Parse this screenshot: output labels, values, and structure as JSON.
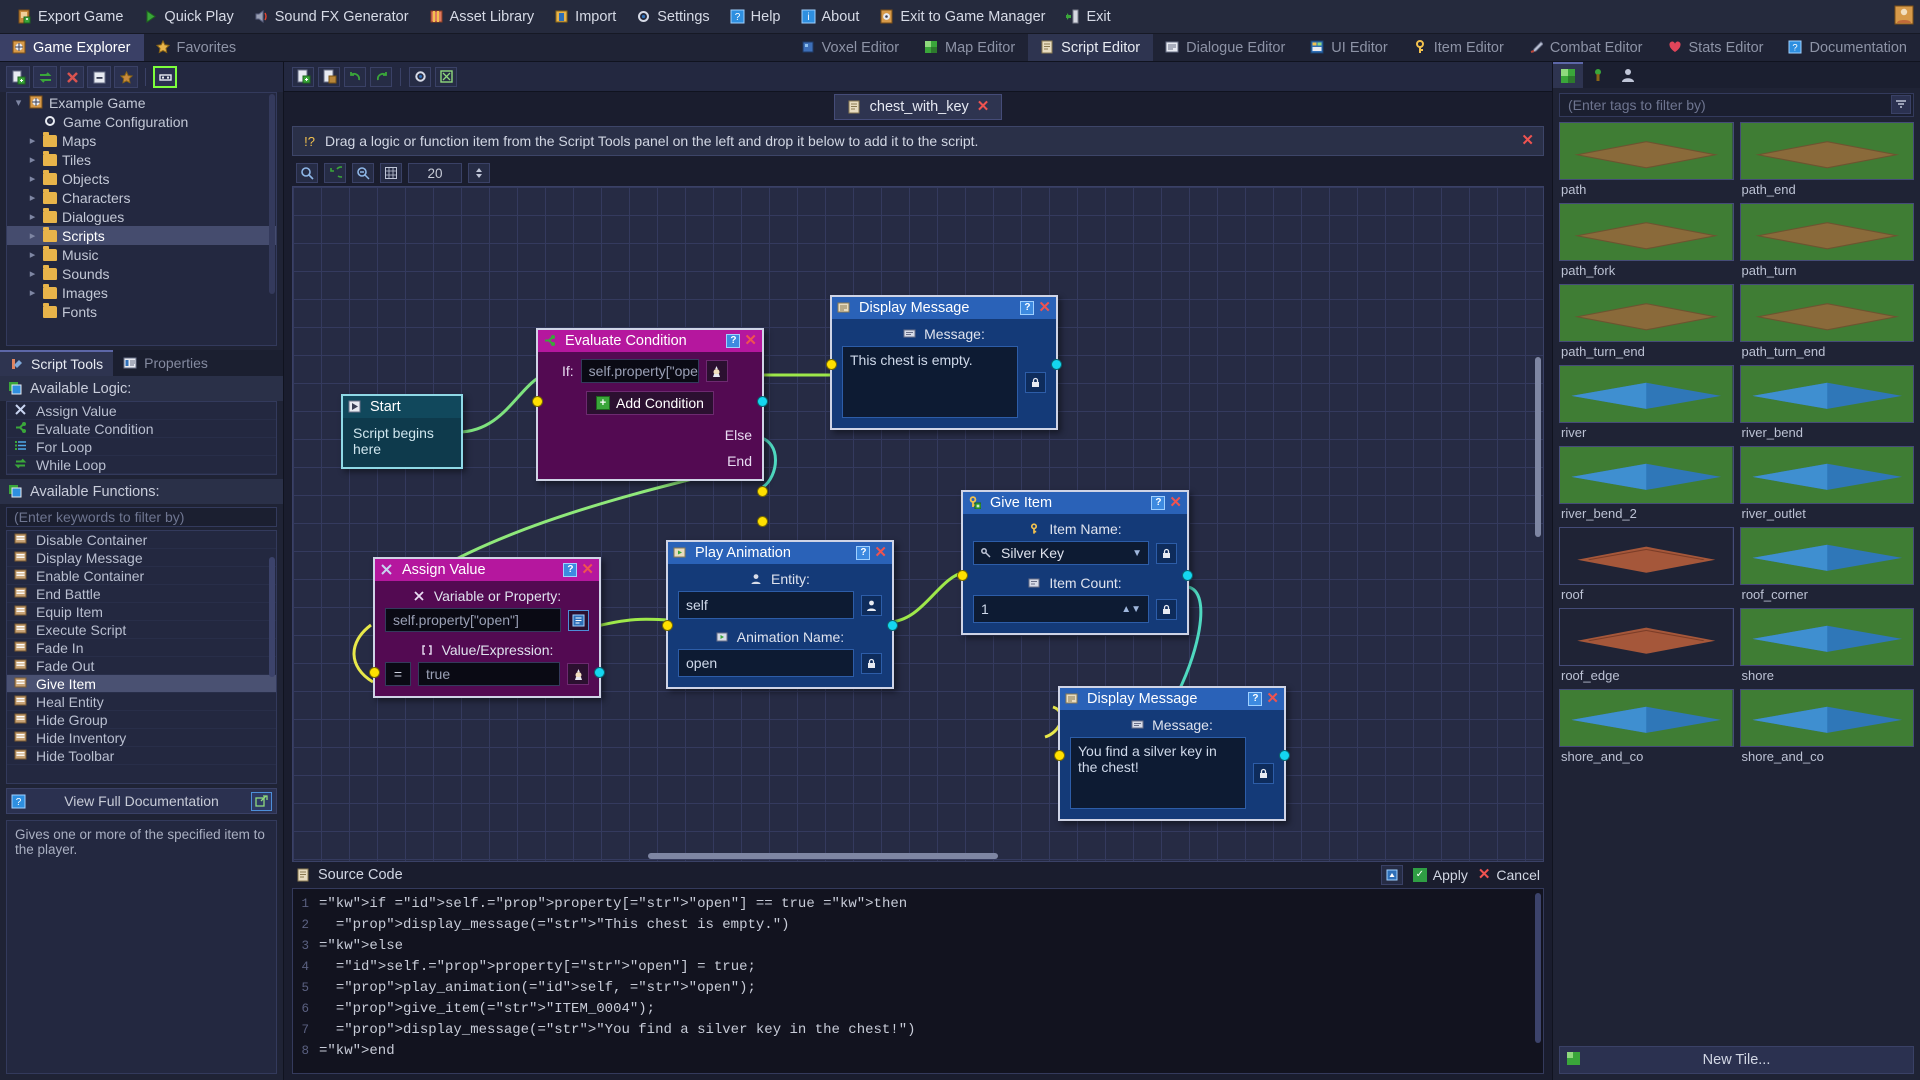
{
  "menubar": {
    "items": [
      {
        "label": "Export Game",
        "icon": "export-icon"
      },
      {
        "label": "Quick Play",
        "icon": "play-icon"
      },
      {
        "label": "Sound FX Generator",
        "icon": "speaker-icon"
      },
      {
        "label": "Asset Library",
        "icon": "library-icon"
      },
      {
        "label": "Import",
        "icon": "import-icon"
      },
      {
        "label": "Settings",
        "icon": "gear-icon"
      },
      {
        "label": "Help",
        "icon": "question-icon"
      },
      {
        "label": "About",
        "icon": "info-icon"
      },
      {
        "label": "Exit to Game Manager",
        "icon": "door-icon"
      },
      {
        "label": "Exit",
        "icon": "exit-icon"
      }
    ]
  },
  "tabbar": {
    "left": [
      {
        "label": "Game Explorer",
        "active": true
      },
      {
        "label": "Favorites",
        "active": false
      }
    ],
    "right": [
      {
        "label": "Voxel Editor",
        "active": false
      },
      {
        "label": "Map Editor",
        "active": false
      },
      {
        "label": "Script Editor",
        "active": true
      },
      {
        "label": "Dialogue Editor",
        "active": false
      },
      {
        "label": "UI Editor",
        "active": false
      },
      {
        "label": "Item Editor",
        "active": false
      },
      {
        "label": "Combat Editor",
        "active": false
      },
      {
        "label": "Stats Editor",
        "active": false
      },
      {
        "label": "Documentation",
        "active": false
      }
    ]
  },
  "explorer": {
    "toolbar": [
      "new-file-icon",
      "refresh-icon",
      "delete-icon",
      "collapse-icon",
      "favorite-icon",
      "rename-icon"
    ],
    "tree": [
      {
        "label": "Example Game",
        "depth": 0,
        "twisty": "v",
        "icon": "game-icon",
        "selected": false
      },
      {
        "label": "Game Configuration",
        "depth": 1,
        "twisty": "",
        "icon": "gear-icon",
        "selected": false
      },
      {
        "label": "Maps",
        "depth": 1,
        "twisty": ">",
        "icon": "folder",
        "selected": false
      },
      {
        "label": "Tiles",
        "depth": 1,
        "twisty": ">",
        "icon": "folder",
        "selected": false
      },
      {
        "label": "Objects",
        "depth": 1,
        "twisty": ">",
        "icon": "folder",
        "selected": false
      },
      {
        "label": "Characters",
        "depth": 1,
        "twisty": ">",
        "icon": "folder",
        "selected": false
      },
      {
        "label": "Dialogues",
        "depth": 1,
        "twisty": ">",
        "icon": "folder",
        "selected": false
      },
      {
        "label": "Scripts",
        "depth": 1,
        "twisty": ">",
        "icon": "folder",
        "selected": true
      },
      {
        "label": "Music",
        "depth": 1,
        "twisty": ">",
        "icon": "folder",
        "selected": false
      },
      {
        "label": "Sounds",
        "depth": 1,
        "twisty": ">",
        "icon": "folder",
        "selected": false
      },
      {
        "label": "Images",
        "depth": 1,
        "twisty": ">",
        "icon": "folder",
        "selected": false
      },
      {
        "label": "Fonts",
        "depth": 1,
        "twisty": "",
        "icon": "folder",
        "selected": false
      }
    ]
  },
  "tools": {
    "tabs": [
      {
        "label": "Script Tools",
        "active": true
      },
      {
        "label": "Properties",
        "active": false
      }
    ],
    "logic_header": "Available Logic:",
    "logic": [
      {
        "label": "Assign Value",
        "icon": "assign-icon"
      },
      {
        "label": "Evaluate Condition",
        "icon": "branch-icon"
      },
      {
        "label": "For Loop",
        "icon": "list-icon"
      },
      {
        "label": "While Loop",
        "icon": "loop-icon"
      }
    ],
    "functions_header": "Available Functions:",
    "filter_placeholder": "(Enter keywords to filter by)",
    "functions": [
      {
        "label": "Disable Container",
        "selected": false
      },
      {
        "label": "Display Message",
        "selected": false
      },
      {
        "label": "Enable Container",
        "selected": false
      },
      {
        "label": "End Battle",
        "selected": false
      },
      {
        "label": "Equip Item",
        "selected": false
      },
      {
        "label": "Execute Script",
        "selected": false
      },
      {
        "label": "Fade In",
        "selected": false
      },
      {
        "label": "Fade Out",
        "selected": false
      },
      {
        "label": "Give Item",
        "selected": true
      },
      {
        "label": "Heal Entity",
        "selected": false
      },
      {
        "label": "Hide Group",
        "selected": false
      },
      {
        "label": "Hide Inventory",
        "selected": false
      },
      {
        "label": "Hide Toolbar",
        "selected": false
      }
    ],
    "doc_button": "View Full Documentation",
    "status_text": "Gives one or more of the specified item to the player."
  },
  "editor": {
    "toolbar_icons": [
      "save-icon",
      "open-icon",
      "undo-icon",
      "redo-icon",
      "gear-icon",
      "clear-icon"
    ],
    "document_tab": "chest_with_key",
    "info_message": "Drag a logic or function item from the Script Tools panel on the left and drop it below to add it to the script.",
    "canvas_tools": [
      "zoom-icon",
      "reset-icon",
      "fit-icon",
      "grid-icon"
    ],
    "grid_value": "20"
  },
  "nodes": {
    "start": {
      "title": "Start",
      "text": "Script begins here"
    },
    "evaluate": {
      "title": "Evaluate Condition",
      "if_label": "If:",
      "condition": "self.property[\"open\"] == t",
      "add_condition": "Add Condition",
      "else_label": "Else",
      "end_label": "End"
    },
    "display1": {
      "title": "Display Message",
      "field_label": "Message:",
      "message": "This chest is empty."
    },
    "assign": {
      "title": "Assign Value",
      "var_label": "Variable or Property:",
      "variable": "self.property[\"open\"]",
      "value_label": "Value/Expression:",
      "operator": "=",
      "value": "true"
    },
    "animation": {
      "title": "Play Animation",
      "entity_label": "Entity:",
      "entity": "self",
      "anim_label": "Animation Name:",
      "anim": "open"
    },
    "give": {
      "title": "Give Item",
      "name_label": "Item Name:",
      "item_name": "Silver Key",
      "count_label": "Item Count:",
      "item_count": "1"
    },
    "display2": {
      "title": "Display Message",
      "field_label": "Message:",
      "message": "You find a silver key in the chest!"
    }
  },
  "source": {
    "title": "Source Code",
    "apply": "Apply",
    "cancel": "Cancel",
    "lines": [
      {
        "n": "1",
        "t": "if self.property[\"open\"] == true then"
      },
      {
        "n": "2",
        "t": "  display_message(\"This chest is empty.\")"
      },
      {
        "n": "3",
        "t": "else"
      },
      {
        "n": "4",
        "t": "  self.property[\"open\"] = true;"
      },
      {
        "n": "5",
        "t": "  play_animation(self, \"open\");"
      },
      {
        "n": "6",
        "t": "  give_item(\"ITEM_0004\");"
      },
      {
        "n": "7",
        "t": "  display_message(\"You find a silver key in the chest!\")"
      },
      {
        "n": "8",
        "t": "end"
      }
    ]
  },
  "palette": {
    "tabs": [
      "tiles-tab",
      "objects-tab",
      "characters-tab"
    ],
    "filter_placeholder": "(Enter tags to filter by)",
    "new_tile": "New Tile...",
    "tiles": [
      {
        "name": "path",
        "kind": "path"
      },
      {
        "name": "path_end",
        "kind": "path"
      },
      {
        "name": "path_fork",
        "kind": "path"
      },
      {
        "name": "path_turn",
        "kind": "path"
      },
      {
        "name": "path_turn_end",
        "kind": "path"
      },
      {
        "name": "path_turn_end",
        "kind": "path"
      },
      {
        "name": "river",
        "kind": "water"
      },
      {
        "name": "river_bend",
        "kind": "water"
      },
      {
        "name": "river_bend_2",
        "kind": "water"
      },
      {
        "name": "river_outlet",
        "kind": "water"
      },
      {
        "name": "roof",
        "kind": "roof"
      },
      {
        "name": "roof_corner",
        "kind": "water"
      },
      {
        "name": "roof_edge",
        "kind": "roof"
      },
      {
        "name": "shore",
        "kind": "water"
      },
      {
        "name": "shore_and_co",
        "kind": "water"
      },
      {
        "name": "shore_and_co",
        "kind": "water"
      }
    ]
  }
}
